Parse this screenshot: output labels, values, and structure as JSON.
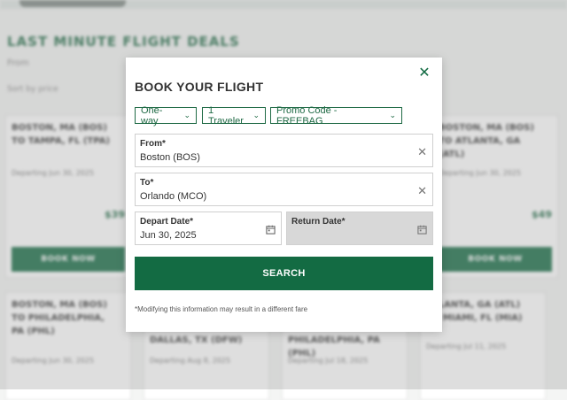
{
  "background": {
    "heading": "LAST MINUTE FLIGHT DEALS",
    "subheading": "From",
    "subheading2": "Sort by price",
    "cards": [
      {
        "route": "BOSTON, MA (BOS) TO TAMPA, FL (TPA)",
        "departing": "Departing Jun 30, 2025",
        "price": "$39",
        "book": "BOOK NOW"
      },
      {
        "route": "BOSTON, MA (BOS) TO ATLANTA, GA (ATL)",
        "departing": "Departing Jun 30, 2025",
        "price": "$49",
        "book": "BOOK NOW"
      },
      {
        "route": "BOSTON, MA (BOS) TO PHILADELPHIA, PA (PHL)",
        "departing": "Departing Jun 30, 2025"
      },
      {
        "route": "DALLAS, TX (DFW)",
        "departing": "Departing Aug 8, 2025"
      },
      {
        "route": "PHILADELPHIA, PA (PHL)",
        "departing": "Departing Jul 18, 2025"
      },
      {
        "route": "ATLANTA, GA (ATL) TO MIAMI, FL (MIA)",
        "departing": "Departing Jul 11, 2025"
      }
    ]
  },
  "modal": {
    "title": "BOOK YOUR FLIGHT",
    "close_icon": "close-icon",
    "trip_type": "One-way",
    "travelers": "1 Traveler",
    "promo": "Promo Code - FREEBAG",
    "from_label": "From*",
    "from_value": "Boston (BOS)",
    "to_label": "To*",
    "to_value": "Orlando (MCO)",
    "depart_label": "Depart Date*",
    "depart_value": "Jun 30, 2025",
    "return_label": "Return Date*",
    "return_value": "",
    "search_label": "SEARCH",
    "disclaimer": "*Modifying this information may result in a different fare"
  },
  "colors": {
    "brand": "#136b43",
    "overlay": "#a0a0a0"
  }
}
